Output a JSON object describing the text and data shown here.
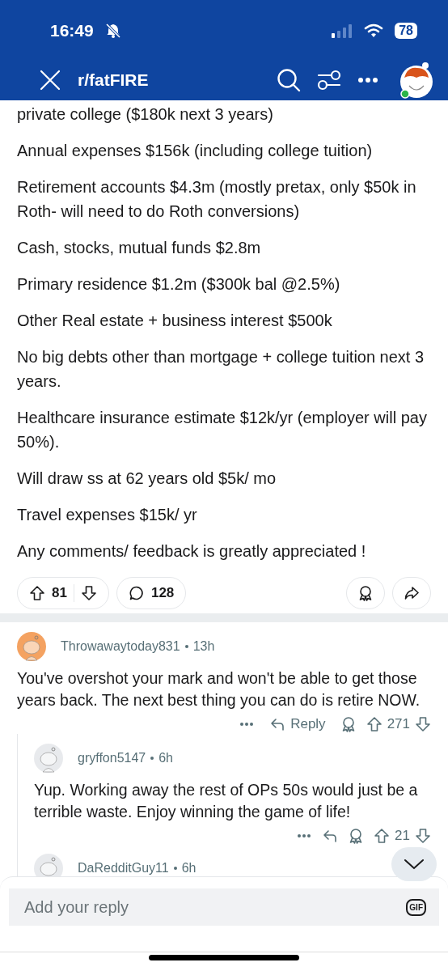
{
  "status_bar": {
    "time": "16:49",
    "battery": "78"
  },
  "header": {
    "subreddit": "r/fatFIRE"
  },
  "post": {
    "paragraphs": [
      "private college ($180k next 3 years)",
      "Annual expenses $156k (including college tuition)",
      "Retirement accounts $4.3m (mostly pretax, only $50k in Roth- will need to do Roth conversions)",
      "Cash, stocks, mutual funds $2.8m",
      "Primary residence $1.2m ($300k bal @2.5%)",
      "Other Real estate + business interest $500k",
      "No big debts other than mortgage + college tuition next 3 years.",
      "Healthcare insurance estimate $12k/yr (employer will pay 50%).",
      "Will draw ss at 62 years old $5k/ mo",
      "Travel expenses $15k/ yr",
      "Any comments/ feedback is greatly appreciated !"
    ],
    "upvotes": "81",
    "comments": "128"
  },
  "comments": [
    {
      "author": "Throwawaytoday831",
      "age": "13h",
      "color": "#f4a261",
      "body": "You've overshot your mark and won't be able to get those years back. The next best thing you can do is retire NOW.",
      "reply_label": "Reply",
      "votes": "271",
      "children": [
        {
          "author": "gryffon5147",
          "age": "6h",
          "color": "#e8eaed",
          "body": "Yup.  Working away the rest of OPs 50s would just be a terrible waste.  Enjoy winning the game of life!",
          "votes": "21"
        },
        {
          "author": "DaRedditGuy11",
          "age": "6h",
          "color": "#e8eaed"
        }
      ]
    }
  ],
  "reply_field": {
    "placeholder": "Add your reply",
    "gif": "GIF"
  }
}
